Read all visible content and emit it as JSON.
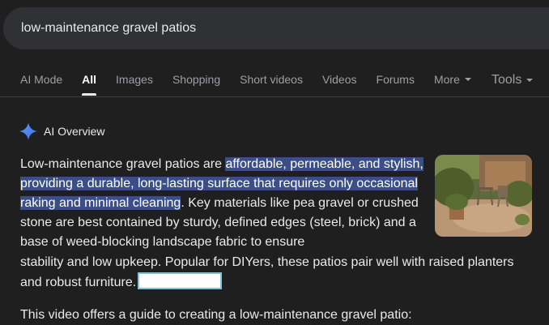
{
  "search": {
    "query": "low-maintenance gravel patios"
  },
  "tabs": [
    {
      "label": "AI Mode",
      "active": false
    },
    {
      "label": "All",
      "active": true
    },
    {
      "label": "Images",
      "active": false
    },
    {
      "label": "Shopping",
      "active": false
    },
    {
      "label": "Short videos",
      "active": false
    },
    {
      "label": "Videos",
      "active": false
    },
    {
      "label": "Forums",
      "active": false
    },
    {
      "label": "More",
      "active": false
    }
  ],
  "tools": {
    "label": "Tools"
  },
  "ai_overview": {
    "title": "AI Overview",
    "icon": "sparkle-icon",
    "intro": "Low-maintenance gravel patios are ",
    "highlight": "affordable, permeable, and stylish, providing a durable, long-lasting surface that requires only occasional raking and minimal cleaning",
    "after_highlight": ". Key materials like pea gravel or crushed stone are best contained by sturdy, defined edges (steel, brick) and a base of weed-blocking landscape fabric to ensure",
    "continuation": "stability and low upkeep. Popular for DIYers, these patios pair well with raised planters and robust furniture.",
    "video_intro": "This video offers a guide to creating a low-maintenance gravel patio:"
  },
  "colors": {
    "background": "#1f1f1f",
    "search_bar": "#303134",
    "highlight": "#3b4f86",
    "sparkle": "#4c8df6"
  }
}
